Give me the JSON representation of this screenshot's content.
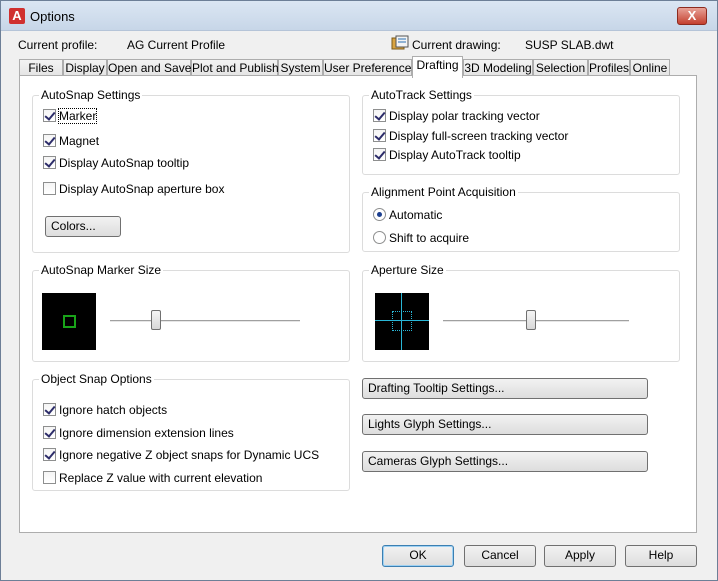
{
  "window": {
    "title": "Options",
    "app_icon": "A",
    "close_glyph": "X"
  },
  "header": {
    "profile_label": "Current profile:",
    "profile_value": "AG Current Profile",
    "drawing_label": "Current drawing:",
    "drawing_value": "SUSP SLAB.dwt"
  },
  "tabs": [
    {
      "label": "Files"
    },
    {
      "label": "Display"
    },
    {
      "label": "Open and Save"
    },
    {
      "label": "Plot and Publish"
    },
    {
      "label": "System"
    },
    {
      "label": "User Preferences"
    },
    {
      "label": "Drafting"
    },
    {
      "label": "3D Modeling"
    },
    {
      "label": "Selection"
    },
    {
      "label": "Profiles"
    },
    {
      "label": "Online"
    }
  ],
  "active_tab": "Drafting",
  "autosnap": {
    "title": "AutoSnap Settings",
    "marker": "Marker",
    "magnet": "Magnet",
    "tooltip": "Display AutoSnap tooltip",
    "aperture_box": "Display AutoSnap aperture box",
    "colors_button": "Colors...",
    "checked": {
      "marker": true,
      "magnet": true,
      "tooltip": true,
      "aperture_box": false
    }
  },
  "autotrack": {
    "title": "AutoTrack Settings",
    "polar": "Display polar tracking vector",
    "fullscreen": "Display full-screen tracking vector",
    "tooltip": "Display AutoTrack tooltip",
    "checked": {
      "polar": true,
      "fullscreen": true,
      "tooltip": true
    }
  },
  "alignment": {
    "title": "Alignment Point Acquisition",
    "automatic": "Automatic",
    "shift": "Shift to acquire",
    "selected": "automatic"
  },
  "marker_size": {
    "title": "AutoSnap Marker Size",
    "slider_fraction": 0.23
  },
  "aperture_size": {
    "title": "Aperture Size",
    "slider_fraction": 0.47
  },
  "object_snap": {
    "title": "Object Snap Options",
    "hatch": "Ignore hatch objects",
    "dimension": "Ignore dimension extension lines",
    "negative_z": "Ignore negative Z object snaps for Dynamic UCS",
    "replace_z": "Replace Z value with current elevation",
    "checked": {
      "hatch": true,
      "dimension": true,
      "negative_z": true,
      "replace_z": false
    }
  },
  "side_buttons": {
    "tooltip": "Drafting Tooltip Settings...",
    "lights": "Lights Glyph Settings...",
    "cameras": "Cameras Glyph Settings..."
  },
  "footer": {
    "ok": "OK",
    "cancel": "Cancel",
    "apply": "Apply",
    "help": "Help"
  },
  "colors": {
    "marker_green": "#19a319",
    "aperture_cyan": "#29b6d6"
  }
}
